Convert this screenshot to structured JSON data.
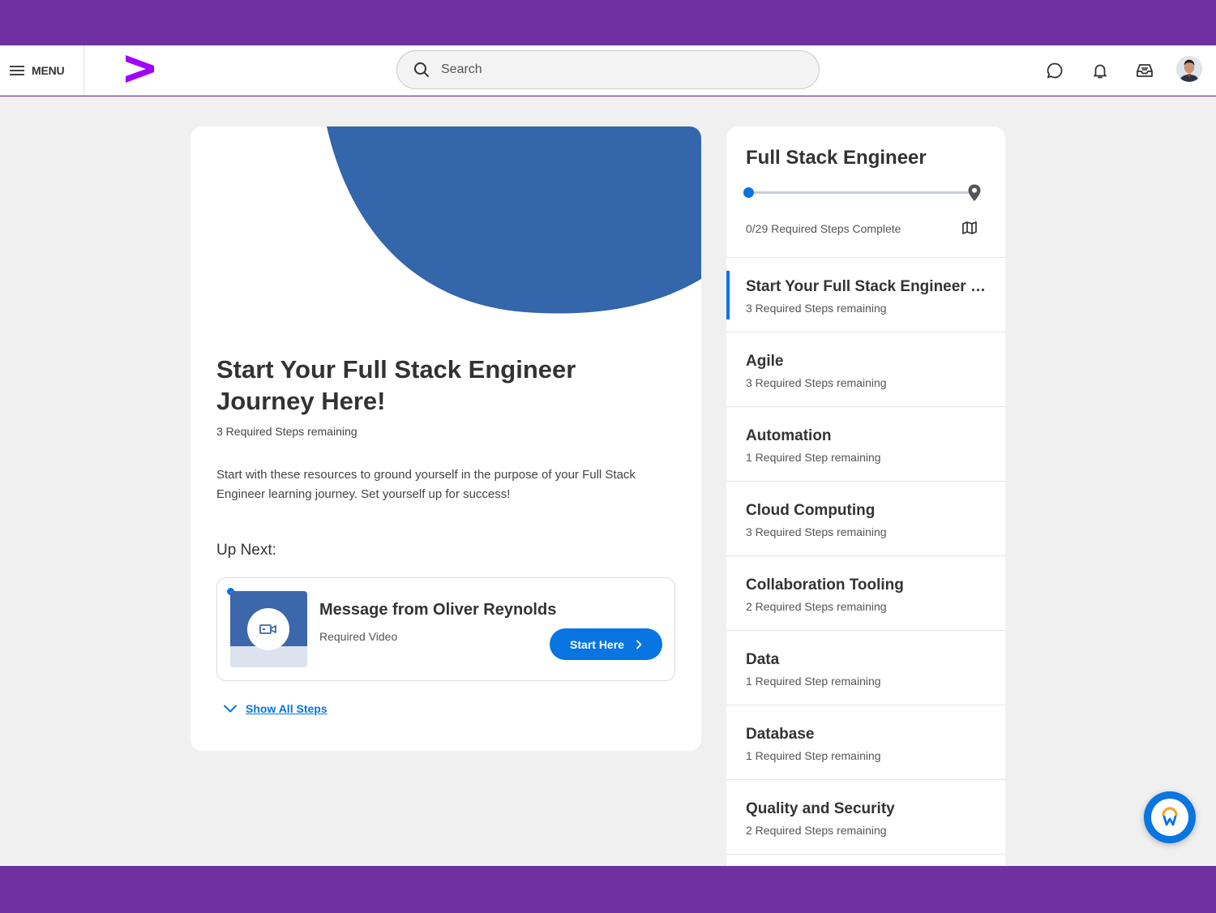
{
  "header": {
    "menu_label": "MENU",
    "search_placeholder": "Search",
    "icons": [
      "chat-icon",
      "bell-icon",
      "inbox-icon"
    ]
  },
  "colors": {
    "brand_purple": "#7030a0",
    "accent_blue": "#0875e1",
    "hero_blue": "#3366aa",
    "logo_magenta": "#a100ff"
  },
  "journey": {
    "title": "Start Your Full Stack Engineer Journey Here!",
    "steps_remaining": "3 Required Steps remaining",
    "description": "Start with these resources to ground yourself in the purpose of your Full Stack Engineer learning journey. Set yourself up for success!",
    "up_next_label": "Up Next:",
    "next_item": {
      "title": "Message from Oliver Reynolds",
      "type": "Required Video",
      "button_label": "Start Here",
      "icon": "video-icon"
    },
    "show_all_label": "Show All Steps"
  },
  "sidebar": {
    "title": "Full Stack Engineer",
    "progress_text": "0/29 Required Steps Complete",
    "progress_fraction": 0,
    "sections": [
      {
        "name": "Start Your Full Stack Engineer Jou...",
        "remaining": "3 Required Steps remaining",
        "active": true
      },
      {
        "name": "Agile",
        "remaining": "3 Required Steps remaining"
      },
      {
        "name": "Automation",
        "remaining": "1 Required Step remaining"
      },
      {
        "name": "Cloud Computing",
        "remaining": "3 Required Steps remaining"
      },
      {
        "name": "Collaboration Tooling",
        "remaining": "2 Required Steps remaining"
      },
      {
        "name": "Data",
        "remaining": "1 Required Step remaining"
      },
      {
        "name": "Database",
        "remaining": "1 Required Step remaining"
      },
      {
        "name": "Quality and Security",
        "remaining": "2 Required Steps remaining"
      }
    ]
  }
}
